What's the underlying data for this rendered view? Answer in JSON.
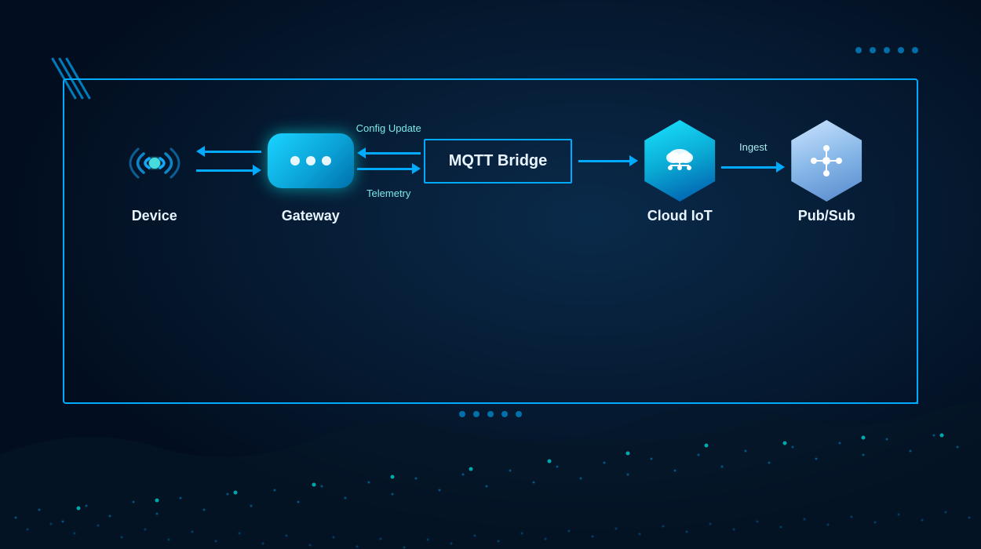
{
  "background": {
    "color": "#020e1f"
  },
  "dots_top_right": [
    "dot",
    "dot",
    "dot",
    "dot",
    "dot"
  ],
  "dots_bottom_center": [
    "dot",
    "dot",
    "dot",
    "dot",
    "dot"
  ],
  "diagram": {
    "nodes": [
      {
        "id": "device",
        "label": "Device"
      },
      {
        "id": "gateway",
        "label": "Gateway"
      },
      {
        "id": "mqtt",
        "label": "MQTT Bridge"
      },
      {
        "id": "cloud_iot",
        "label": "Cloud IoT"
      },
      {
        "id": "pubsub",
        "label": "Pub/Sub"
      }
    ],
    "connectors": [
      {
        "id": "device-gateway",
        "type": "double",
        "label_top": "",
        "label_bottom": ""
      },
      {
        "id": "gateway-mqtt",
        "type": "vertical",
        "label_top": "Config Update",
        "label_bottom": "Telemetry"
      },
      {
        "id": "mqtt-cloudiot",
        "type": "single",
        "label": ""
      },
      {
        "id": "cloudiot-pubsub",
        "type": "single",
        "label": "Ingest"
      }
    ]
  }
}
